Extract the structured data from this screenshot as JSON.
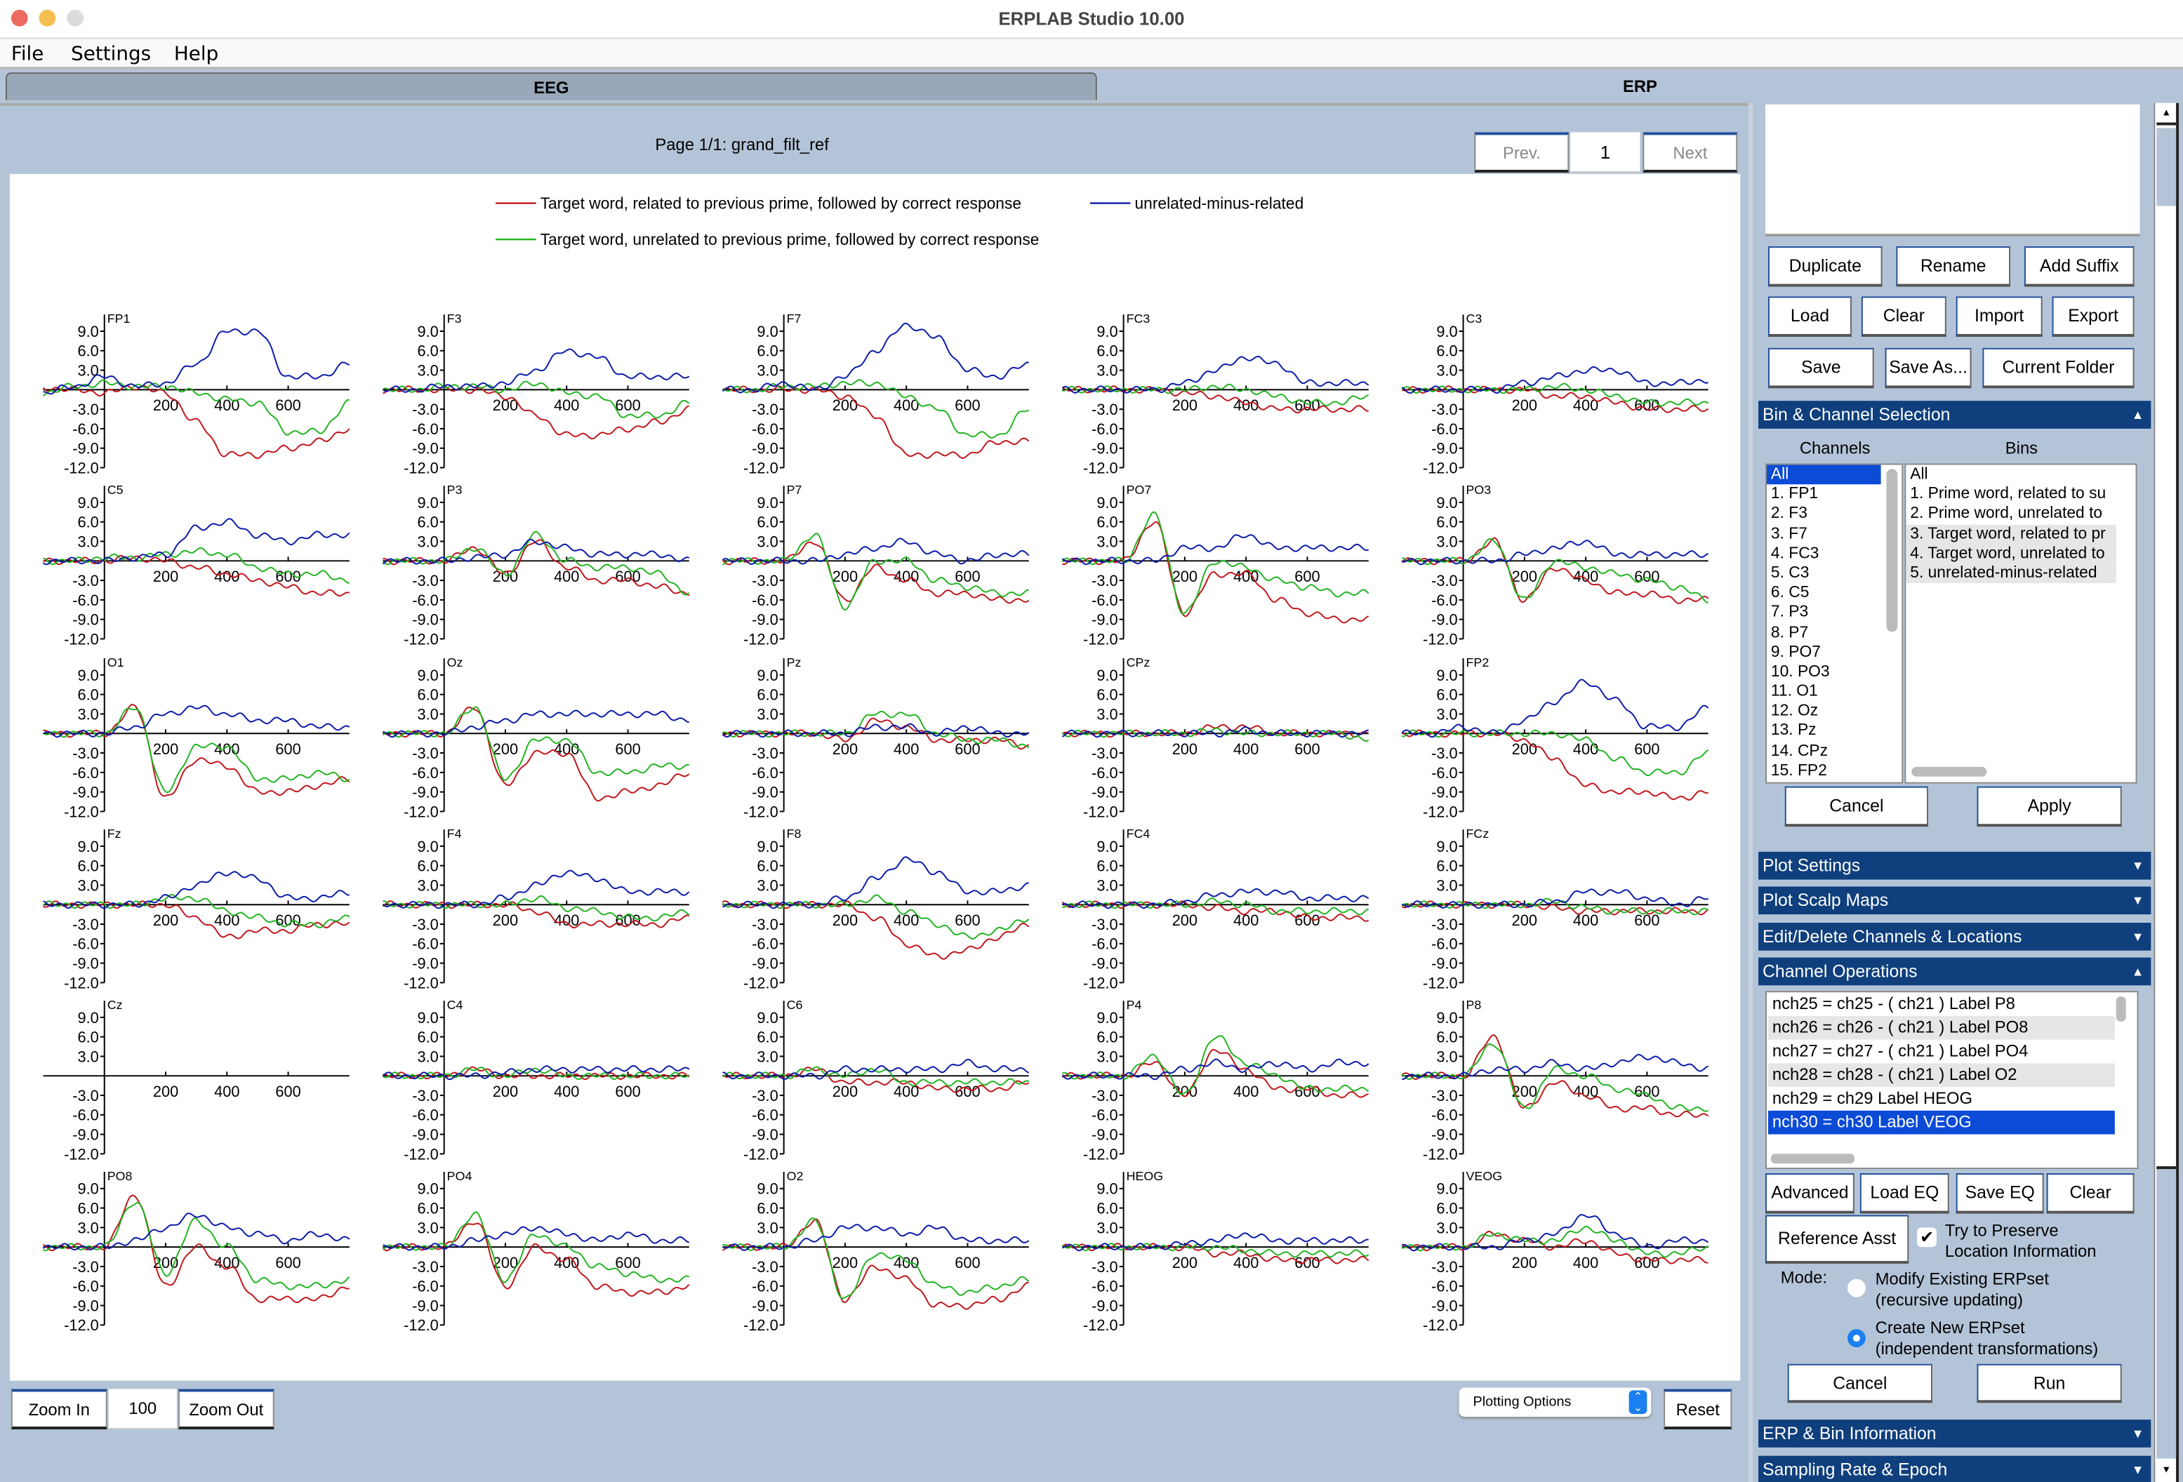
{
  "window": {
    "title": "ERPLAB Studio 10.00"
  },
  "menu": [
    "File",
    "Settings",
    "Help"
  ],
  "tabs": [
    {
      "label": "EEG",
      "active": false
    },
    {
      "label": "ERP",
      "active": true
    }
  ],
  "plot_header": {
    "page_label": "Page 1/1: grand_filt_ref",
    "prev": "Prev.",
    "page_input": "1",
    "next": "Next"
  },
  "legend": [
    {
      "label": "Target word, related to previous prime, followed by correct response",
      "color": "#c0161c"
    },
    {
      "label": "unrelated-minus-related",
      "color": "#0a1aa8"
    },
    {
      "label": "Target word, unrelated to previous prime, followed by correct response",
      "color": "#22b422"
    }
  ],
  "axes": {
    "y_ticks": [
      9,
      6,
      3,
      -3,
      -6,
      -9,
      -12
    ],
    "y_tick_labels": [
      "9.0",
      "6.0",
      "3.0",
      "-3.0",
      "-6.0",
      "-9.0",
      "-12.0"
    ],
    "x_ticks": [
      200,
      400,
      600
    ],
    "x_tick_labels": [
      "200",
      "400",
      "600"
    ],
    "x_range_ms": [
      -200,
      800
    ],
    "y_range_uv": [
      -12,
      11
    ],
    "sample_times_ms": [
      -200,
      -100,
      0,
      100,
      200,
      300,
      400,
      500,
      600,
      700,
      800
    ]
  },
  "channels": [
    {
      "label": "FP1",
      "red": [
        0.3,
        0,
        -0.5,
        0.5,
        -0.5,
        -5,
        -10,
        -10,
        -9,
        -8,
        -6
      ],
      "green": [
        -0.5,
        0.5,
        1,
        0.5,
        0.5,
        -0.5,
        -1.5,
        -2,
        -6.5,
        -6.5,
        -2
      ],
      "blue": [
        -0.5,
        0.5,
        2,
        0.5,
        1,
        4,
        9,
        9,
        2,
        2,
        4
      ]
    },
    {
      "label": "F3",
      "red": [
        0,
        0,
        0,
        0,
        -1,
        -4,
        -7,
        -7,
        -6,
        -5,
        -3
      ],
      "green": [
        0,
        0,
        0.5,
        0.5,
        0,
        1,
        -0.5,
        -1,
        -4,
        -4,
        -2
      ],
      "blue": [
        0,
        0,
        0.5,
        0.5,
        1,
        3,
        6,
        5,
        2,
        2,
        2
      ]
    },
    {
      "label": "F7",
      "red": [
        0,
        0,
        0,
        0,
        -1,
        -4,
        -10,
        -10,
        -10,
        -8,
        -8
      ],
      "green": [
        0,
        0,
        0.5,
        0.5,
        1,
        1,
        -1,
        -3,
        -7,
        -7,
        -3
      ],
      "blue": [
        0,
        0,
        1,
        0,
        2,
        6,
        10,
        8,
        3,
        2,
        4
      ]
    },
    {
      "label": "FC3",
      "red": [
        0,
        0,
        0,
        0,
        -0.5,
        -1,
        -2,
        -3,
        -3,
        -3,
        -3
      ],
      "green": [
        0,
        0,
        0,
        0,
        0,
        0.5,
        0,
        -1,
        -2,
        -2,
        -1
      ],
      "blue": [
        0,
        0,
        0,
        0,
        1,
        3,
        5,
        4,
        1,
        1,
        1
      ]
    },
    {
      "label": "C3",
      "red": [
        0,
        0,
        0,
        0,
        0,
        -1,
        -1,
        -2,
        -3,
        -3,
        -3
      ],
      "green": [
        0,
        0,
        0,
        0,
        0,
        0.5,
        0,
        -1,
        -2,
        -2,
        -2
      ],
      "blue": [
        0,
        0,
        0,
        0,
        1,
        2,
        3,
        3,
        1,
        1,
        1.5
      ]
    },
    {
      "label": "C5",
      "red": [
        0,
        0,
        0,
        0.5,
        0,
        -1,
        -2,
        -3,
        -4,
        -5,
        -5
      ],
      "green": [
        0,
        0,
        0.5,
        0.5,
        1,
        1.5,
        1,
        -1,
        -2,
        -2,
        -3
      ],
      "blue": [
        0,
        0,
        0,
        0.5,
        1,
        5,
        6,
        4,
        3,
        4,
        4
      ]
    },
    {
      "label": "P3",
      "red": [
        0,
        0,
        0,
        2,
        -2,
        3,
        -1,
        -3,
        -3,
        -4,
        -5
      ],
      "green": [
        0,
        0,
        0,
        2,
        -2,
        4,
        0,
        -1,
        -1,
        -2,
        -5
      ],
      "blue": [
        0,
        0,
        0,
        0.5,
        1,
        3,
        2,
        1,
        1,
        1,
        0
      ]
    },
    {
      "label": "P7",
      "red": [
        0,
        0,
        0,
        3,
        -6,
        -1,
        -3,
        -5,
        -5,
        -6,
        -6
      ],
      "green": [
        0,
        0,
        0,
        4,
        -7,
        0,
        0,
        -3,
        -4,
        -5,
        -5
      ],
      "blue": [
        0,
        0,
        0,
        0,
        1,
        2,
        3,
        1,
        0,
        1,
        1
      ]
    },
    {
      "label": "PO7",
      "red": [
        0,
        0,
        0,
        6,
        -8,
        -2,
        -2,
        -6,
        -8,
        -9,
        -9
      ],
      "green": [
        0,
        0,
        0,
        7,
        -8,
        0,
        -1,
        -3,
        -4,
        -5,
        -5
      ],
      "blue": [
        0,
        0,
        0,
        0,
        2,
        2,
        4,
        2,
        2,
        2,
        2
      ]
    },
    {
      "label": "PO3",
      "red": [
        0,
        0,
        0,
        3,
        -6,
        -1,
        -3,
        -5,
        -5,
        -6,
        -6
      ],
      "green": [
        0,
        0,
        0,
        3,
        -6,
        0,
        -1,
        -2,
        -3,
        -4,
        -6
      ],
      "blue": [
        0,
        0,
        0,
        0,
        1,
        2,
        3,
        1,
        1,
        1,
        1
      ]
    },
    {
      "label": "O1",
      "red": [
        0,
        0,
        0,
        4,
        -10,
        -4,
        -5,
        -9,
        -9,
        -8,
        -7
      ],
      "green": [
        0,
        0,
        0,
        4,
        -9,
        -2,
        -2,
        -7,
        -7,
        -6,
        -7
      ],
      "blue": [
        0,
        0,
        0,
        1,
        3,
        4,
        3,
        2,
        2,
        1,
        1
      ]
    },
    {
      "label": "Oz",
      "red": [
        0,
        0,
        0,
        4,
        -8,
        -3,
        -3,
        -10,
        -9,
        -8,
        -6
      ],
      "green": [
        0,
        0,
        0,
        4,
        -7,
        -1,
        -1,
        -6,
        -6,
        -5,
        -5
      ],
      "blue": [
        0,
        0,
        0,
        1,
        2,
        3,
        3,
        3,
        3,
        3,
        2
      ]
    },
    {
      "label": "Pz",
      "red": [
        0,
        0,
        0,
        0,
        -1,
        2,
        1,
        -1,
        -1,
        -1,
        -2
      ],
      "green": [
        0,
        0,
        0,
        0,
        0,
        3,
        3,
        0,
        -1,
        -1,
        -2
      ],
      "blue": [
        0,
        0,
        0,
        0,
        0,
        1,
        1,
        0,
        1,
        0,
        0
      ]
    },
    {
      "label": "CPz",
      "red": [
        0,
        0,
        0,
        0,
        0,
        1,
        1,
        0,
        0,
        0,
        0
      ],
      "green": [
        0,
        0,
        0,
        0,
        0,
        0.5,
        0,
        0,
        0,
        0,
        -1
      ],
      "blue": [
        0,
        0,
        0,
        0,
        0,
        0,
        0.5,
        0,
        0,
        0,
        0
      ]
    },
    {
      "label": "FP2",
      "red": [
        0,
        0,
        0,
        0,
        -1,
        -4,
        -8,
        -9,
        -9,
        -10,
        -9
      ],
      "green": [
        0,
        0,
        0,
        0,
        0,
        0,
        -1,
        -4,
        -6,
        -6,
        -3
      ],
      "blue": [
        0,
        0,
        1,
        0,
        2,
        5,
        8,
        5,
        1,
        1,
        4
      ]
    },
    {
      "label": "Fz",
      "red": [
        0,
        0,
        0,
        0,
        0,
        -2,
        -5,
        -4,
        -4,
        -3,
        -3
      ],
      "green": [
        0,
        0,
        0,
        0,
        1,
        1,
        -1,
        -2,
        -3,
        -3,
        -2
      ],
      "blue": [
        0,
        0,
        0,
        0,
        1,
        3,
        5,
        4,
        1,
        1,
        2
      ]
    },
    {
      "label": "F4",
      "red": [
        0,
        0,
        0,
        0,
        0,
        -1,
        -3,
        -3,
        -3,
        -3,
        -2
      ],
      "green": [
        0,
        0,
        0,
        0,
        0,
        1,
        -0.5,
        -1,
        -2,
        -2,
        -1
      ],
      "blue": [
        0,
        0,
        0,
        0,
        1,
        3,
        5,
        4,
        2,
        2,
        2
      ]
    },
    {
      "label": "F8",
      "red": [
        0,
        0,
        0,
        0,
        0,
        -2,
        -6,
        -8,
        -7,
        -5,
        -3
      ],
      "green": [
        0,
        0,
        0,
        0,
        0,
        1,
        -1,
        -3,
        -5,
        -4,
        -2
      ],
      "blue": [
        0,
        0,
        0,
        0,
        1,
        4,
        7,
        5,
        2,
        2,
        3
      ]
    },
    {
      "label": "FC4",
      "red": [
        0,
        0,
        0,
        0,
        0,
        -0.5,
        -1,
        -1,
        -2,
        -2,
        -2
      ],
      "green": [
        0,
        0,
        0,
        0,
        0,
        0.5,
        0,
        -1,
        -1,
        -1,
        -1
      ],
      "blue": [
        0,
        0,
        0,
        0,
        0.5,
        1.5,
        2,
        2,
        1,
        1,
        1
      ]
    },
    {
      "label": "FCz",
      "red": [
        0,
        0,
        0,
        0,
        0,
        -0.5,
        -1,
        -1,
        -1,
        -1,
        -1
      ],
      "green": [
        0,
        0,
        0,
        0,
        0,
        0.5,
        -0.5,
        -1,
        -1,
        -1,
        -1
      ],
      "blue": [
        0,
        0,
        0,
        0,
        0,
        0.5,
        2,
        2,
        1,
        0,
        1
      ]
    },
    {
      "label": "Cz",
      "red": [],
      "green": [],
      "blue": []
    },
    {
      "label": "C4",
      "red": [
        0,
        0,
        0,
        1,
        0,
        0,
        0,
        0,
        0,
        0,
        0
      ],
      "green": [
        0,
        0,
        0,
        1,
        0,
        1,
        0,
        0,
        0,
        0,
        0
      ],
      "blue": [
        0,
        0,
        0,
        0,
        0.5,
        1,
        1,
        1,
        1,
        1,
        1
      ]
    },
    {
      "label": "C6",
      "red": [
        0,
        0,
        0,
        1,
        -1,
        -1,
        -1,
        -2,
        -2,
        -2,
        -1
      ],
      "green": [
        0,
        0,
        0,
        1,
        0,
        1,
        -1,
        -1,
        -1,
        -1,
        -1
      ],
      "blue": [
        0,
        0,
        0,
        0,
        1,
        1,
        1,
        1,
        2,
        1,
        1
      ]
    },
    {
      "label": "P4",
      "red": [
        0,
        0,
        0,
        2,
        -3,
        4,
        1,
        -2,
        -2,
        -3,
        -3
      ],
      "green": [
        0,
        0,
        0,
        3,
        -3,
        6,
        2,
        0,
        -2,
        -2,
        -2
      ],
      "blue": [
        0,
        0,
        0,
        0,
        1,
        2,
        1,
        2,
        1,
        2,
        2
      ]
    },
    {
      "label": "P8",
      "red": [
        0,
        0,
        0,
        6,
        -5,
        -1,
        -3,
        -5,
        -5,
        -6,
        -6
      ],
      "green": [
        0,
        0,
        0,
        5,
        -5,
        1,
        0,
        -2,
        -3,
        -5,
        -5
      ],
      "blue": [
        0,
        0,
        0,
        1,
        1,
        2,
        1,
        2,
        3,
        2,
        1
      ]
    },
    {
      "label": "PO8",
      "red": [
        0,
        0,
        0,
        8,
        -6,
        0,
        -3,
        -8,
        -8,
        -8,
        -6
      ],
      "green": [
        0,
        0,
        0,
        7,
        -4,
        4,
        0,
        -5,
        -6,
        -6,
        -5
      ],
      "blue": [
        0,
        0,
        0,
        1,
        3,
        5,
        3,
        2,
        1,
        2,
        1
      ]
    },
    {
      "label": "PO4",
      "red": [
        0,
        0,
        0,
        4,
        -6,
        0,
        -2,
        -6,
        -7,
        -7,
        -6
      ],
      "green": [
        0,
        0,
        0,
        5,
        -5,
        2,
        0,
        -3,
        -4,
        -5,
        -5
      ],
      "blue": [
        0,
        0,
        0,
        1,
        2,
        3,
        2,
        1,
        2,
        1,
        1
      ]
    },
    {
      "label": "O2",
      "red": [
        0,
        0,
        0,
        4,
        -8,
        -3,
        -5,
        -9,
        -9,
        -8,
        -6
      ],
      "green": [
        0,
        0,
        0,
        4,
        -8,
        -1,
        -2,
        -6,
        -7,
        -6,
        -5
      ],
      "blue": [
        0,
        0,
        0,
        1,
        3,
        3,
        2,
        3,
        1,
        1,
        1
      ]
    },
    {
      "label": "HEOG",
      "red": [
        0,
        0,
        0,
        0,
        0,
        -1,
        -1,
        -2,
        -2,
        -2,
        -2
      ],
      "green": [
        0,
        0,
        0,
        0,
        0,
        0,
        -0.5,
        -1,
        -1,
        -1,
        -1
      ],
      "blue": [
        0,
        0,
        0,
        0,
        0.5,
        1,
        2,
        1,
        1,
        1,
        1
      ]
    },
    {
      "label": "VEOG",
      "red": [
        0,
        0,
        0,
        2,
        1,
        0,
        1,
        -1,
        -2,
        -2,
        -2
      ],
      "green": [
        0,
        0,
        0,
        2,
        1,
        1,
        3,
        1,
        -1,
        -1,
        0
      ],
      "blue": [
        0,
        0,
        0,
        0,
        1,
        2,
        5,
        2,
        0,
        1,
        1
      ]
    }
  ],
  "bottom_bar": {
    "zoom_in": "Zoom In",
    "zoom_value": "100",
    "zoom_out": "Zoom Out",
    "plotting_options": "Plotting Options",
    "reset": "Reset"
  },
  "erpset_panel": {
    "buttons_row1": [
      "Duplicate",
      "Rename",
      "Add Suffix"
    ],
    "buttons_row2": [
      "Load",
      "Clear",
      "Import",
      "Export"
    ],
    "buttons_row3": [
      "Save",
      "Save As...",
      "Current Folder"
    ]
  },
  "bin_channel": {
    "header": "Bin & Channel Selection",
    "channels_label": "Channels",
    "bins_label": "Bins",
    "channels": [
      "All",
      "1. FP1",
      "2. F3",
      "3. F7",
      "4. FC3",
      "5. C3",
      "6. C5",
      "7. P3",
      "8. P7",
      "9. PO7",
      "10. PO3",
      "11. O1",
      "12. Oz",
      "13. Pz",
      "14. CPz",
      "15. FP2"
    ],
    "bins": [
      "All",
      "1. Prime word, related to su",
      "2. Prime word, unrelated to",
      "3. Target word, related to pr",
      "4. Target word, unrelated to",
      "5. unrelated-minus-related"
    ],
    "cancel": "Cancel",
    "apply": "Apply"
  },
  "collapsed_panels": [
    "Plot Settings",
    "Plot Scalp Maps",
    "Edit/Delete Channels & Locations"
  ],
  "channel_operations": {
    "header": "Channel Operations",
    "equations": [
      "nch25 = ch25 - ( ch21 ) Label P8",
      "nch26 = ch26 - ( ch21 ) Label PO8",
      "nch27 = ch27 - ( ch21 ) Label PO4",
      "nch28 = ch28 - ( ch21 ) Label O2",
      "nch29 = ch29  Label HEOG",
      "nch30 = ch30  Label VEOG"
    ],
    "selected_index": 5,
    "buttons": [
      "Advanced",
      "Load EQ",
      "Save EQ",
      "Clear"
    ],
    "reference_asst": "Reference Asst",
    "preserve_label_1": "Try to Preserve",
    "preserve_label_2": "Location Information",
    "preserve_checked": true,
    "mode_label": "Mode:",
    "mode_modify_1": "Modify Existing ERPset",
    "mode_modify_2": "(recursive updating)",
    "mode_create_1": "Create New ERPset",
    "mode_create_2": "(independent transformations)",
    "mode_selected": "create",
    "cancel": "Cancel",
    "run": "Run"
  },
  "bottom_panels": [
    "ERP & Bin Information",
    "Sampling Rate & Epoch"
  ]
}
